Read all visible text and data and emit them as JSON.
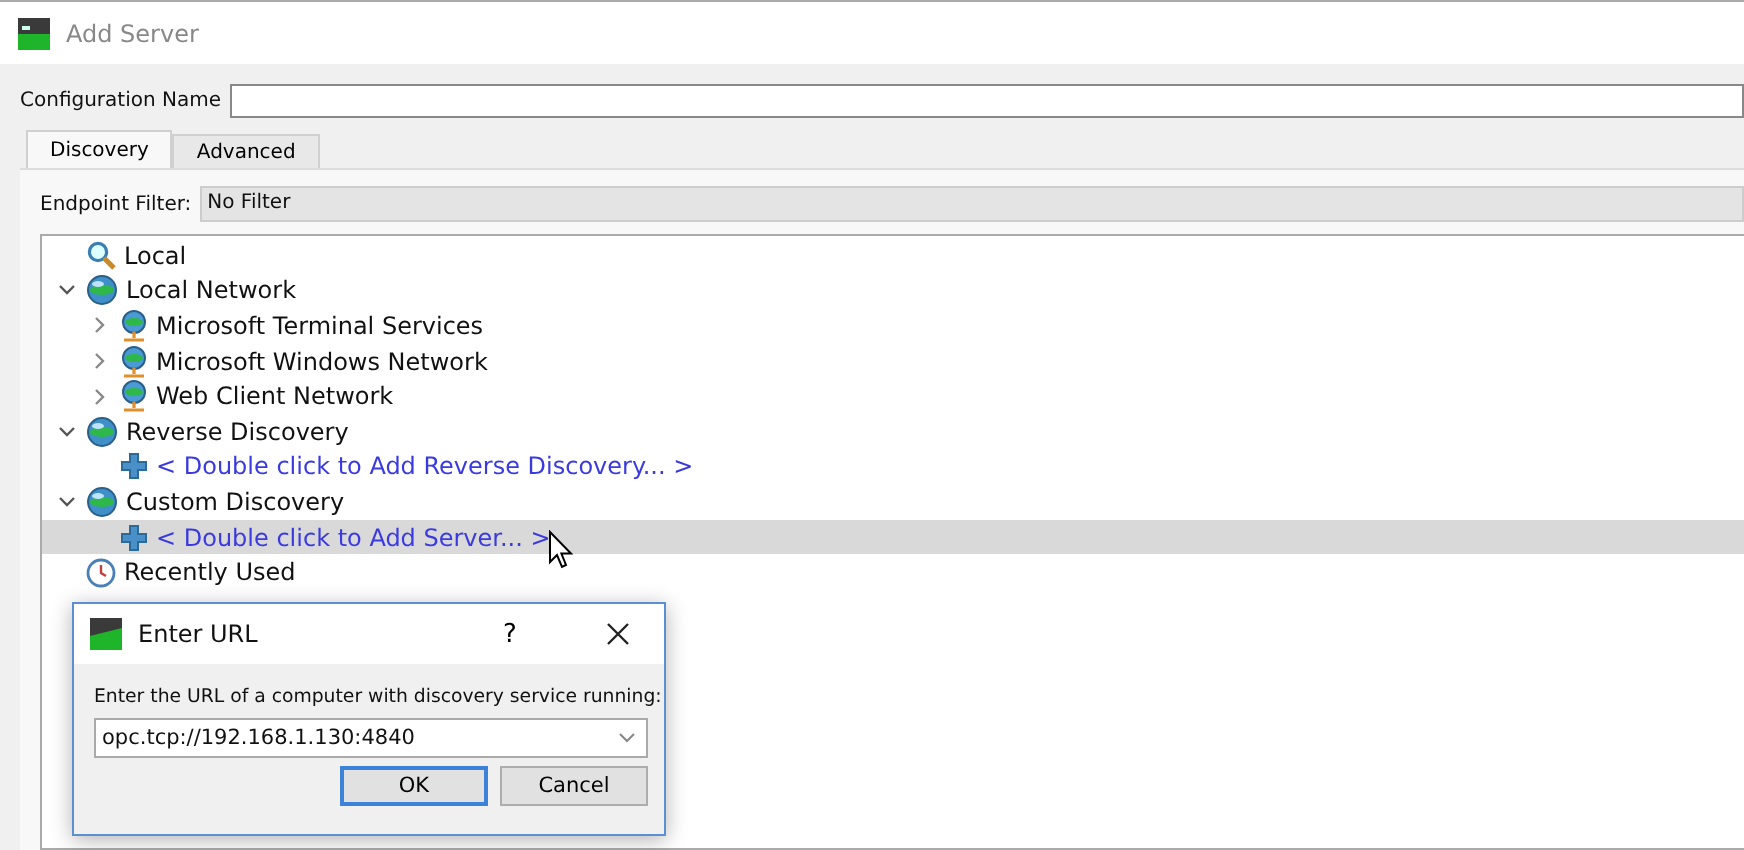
{
  "window": {
    "title": "Add Server"
  },
  "configuration_name": {
    "label": "Configuration Name"
  },
  "tabs": [
    {
      "label": "Discovery",
      "selected": true
    },
    {
      "label": "Advanced",
      "selected": false
    }
  ],
  "endpoint_filter": {
    "label": "Endpoint Filter:",
    "value": "No Filter"
  },
  "tree": [
    {
      "label": "Local",
      "kind": "search",
      "selected": false
    },
    {
      "label": "Local Network",
      "kind": "globe",
      "selected": false,
      "expanded": true,
      "children": [
        {
          "label": "Microsoft Terminal Services",
          "kind": "node",
          "selected": false,
          "expanded": false
        },
        {
          "label": "Microsoft Windows Network",
          "kind": "node",
          "selected": false,
          "expanded": false
        },
        {
          "label": "Web Client Network",
          "kind": "node",
          "selected": false,
          "expanded": false
        }
      ]
    },
    {
      "label": "Reverse Discovery",
      "kind": "globe",
      "selected": false,
      "expanded": true,
      "children": [
        {
          "label": "< Double click to Add Reverse Discovery... >",
          "kind": "add",
          "selected": false
        }
      ]
    },
    {
      "label": "Custom Discovery",
      "kind": "globe",
      "selected": false,
      "expanded": true,
      "children": [
        {
          "label": "< Double click to Add Server... >",
          "kind": "add",
          "selected": true
        }
      ]
    },
    {
      "label": "Recently Used",
      "kind": "clock",
      "selected": false
    }
  ],
  "dialog": {
    "title": "Enter URL",
    "help": "?",
    "prompt": "Enter the URL of a computer with discovery service running:",
    "url": "opc.tcp://192.168.1.130:4840",
    "buttons": [
      {
        "label": "OK",
        "default": true
      },
      {
        "label": "Cancel",
        "default": false
      }
    ]
  }
}
